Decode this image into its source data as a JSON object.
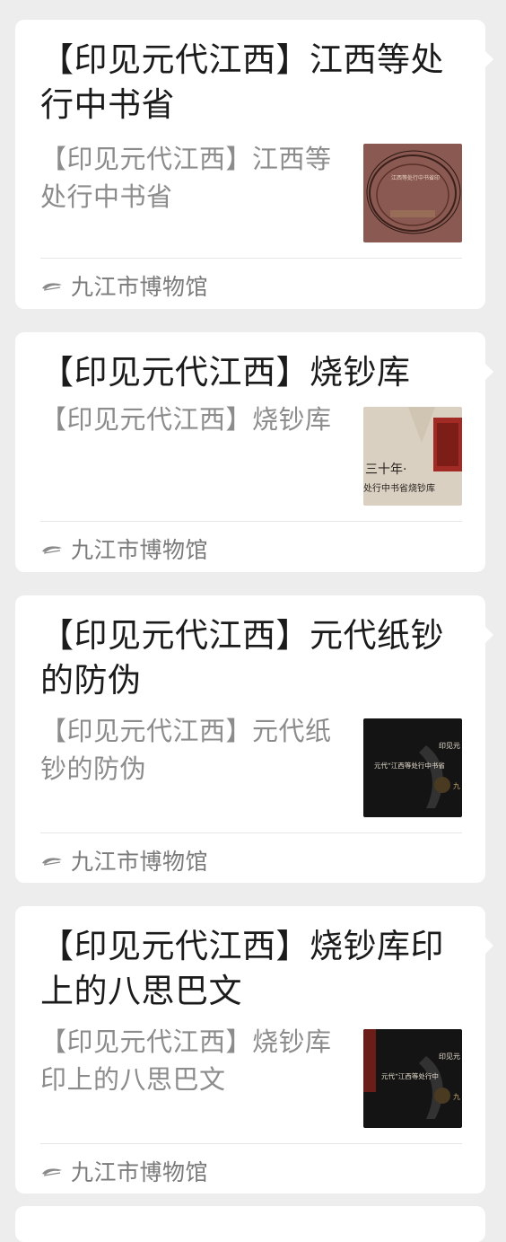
{
  "colors": {
    "background": "#ededed",
    "card": "#ffffff",
    "title": "#1b1b1b",
    "digest": "#8c8c8c",
    "source": "#7a7a7a"
  },
  "articles": [
    {
      "title": "【印见元代江西】江西等处行中书省",
      "digest": "【印见元代江西】江西等处行中书省",
      "source": "九江市博物馆",
      "source_icon": "museum-logo-icon",
      "thumbnail_text": "江西等处行中书省印"
    },
    {
      "title": "【印见元代江西】烧钞库",
      "digest": "【印见元代江西】烧钞库",
      "source": "九江市博物馆",
      "source_icon": "museum-logo-icon",
      "thumbnail_text_1": "三十年·",
      "thumbnail_text_2": "处行中书省烧钞库"
    },
    {
      "title": "【印见元代江西】元代纸钞的防伪",
      "digest": "【印见元代江西】元代纸钞的防伪",
      "source": "九江市博物馆",
      "source_icon": "museum-logo-icon",
      "thumbnail_text_1": "印见元",
      "thumbnail_text_2": "元代“江西等处行中书省",
      "thumbnail_text_3": "九"
    },
    {
      "title": "【印见元代江西】烧钞库印上的八思巴文",
      "digest": "【印见元代江西】烧钞库印上的八思巴文",
      "source": "九江市博物馆",
      "source_icon": "museum-logo-icon",
      "thumbnail_text_1": "印见元",
      "thumbnail_text_2": "元代“江西等处行中",
      "thumbnail_text_3": "九"
    }
  ]
}
